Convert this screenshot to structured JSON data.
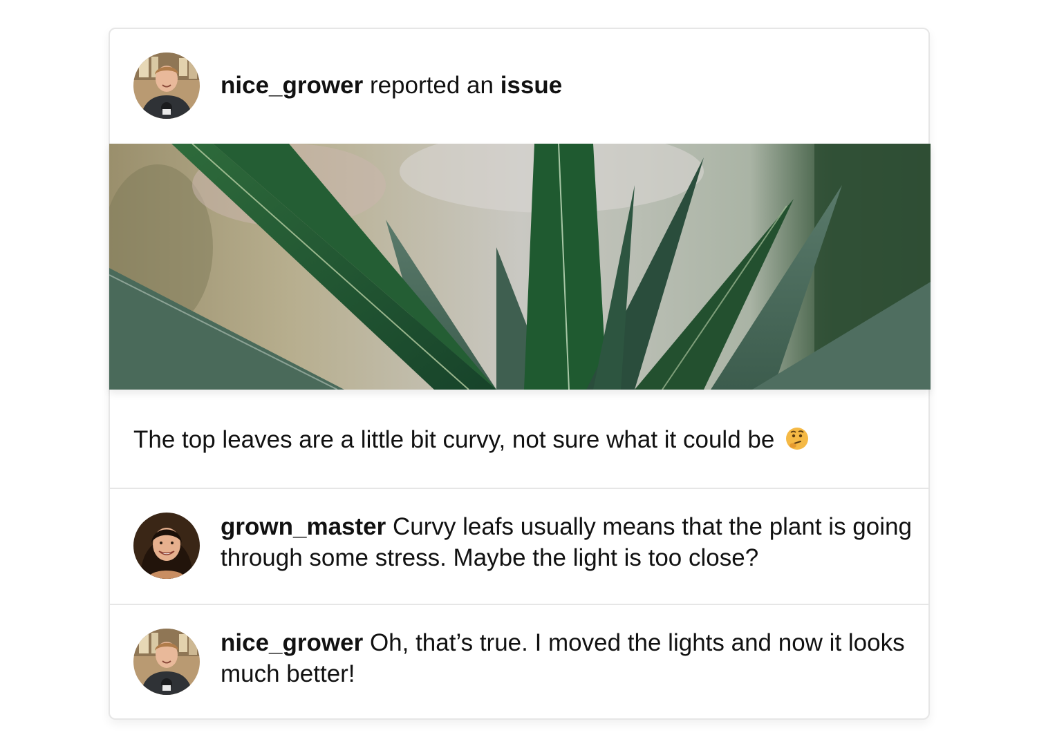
{
  "post": {
    "author": "nice_grower",
    "action_text": "reported an",
    "object_text": "issue",
    "body": "The top leaves are a little bit curvy, not sure what it could be",
    "body_emoji": "thinking-face-emoji"
  },
  "comments": [
    {
      "author": "grown_master",
      "text": "Curvy leafs usually means that the plant is going through some stress. Maybe the light is too close?"
    },
    {
      "author": "nice_grower",
      "text": "Oh, that’s true. I moved the lights and now it looks much better!"
    }
  ],
  "colors": {
    "card_border": "#e6e6e6",
    "text": "#111111",
    "leaf_green": "#1f4d2c",
    "emoji_yellow": "#f5b945"
  },
  "icons": {
    "post_avatar": "avatar-nice-grower",
    "comment1_avatar": "avatar-grown-master",
    "comment2_avatar": "avatar-nice-grower"
  }
}
